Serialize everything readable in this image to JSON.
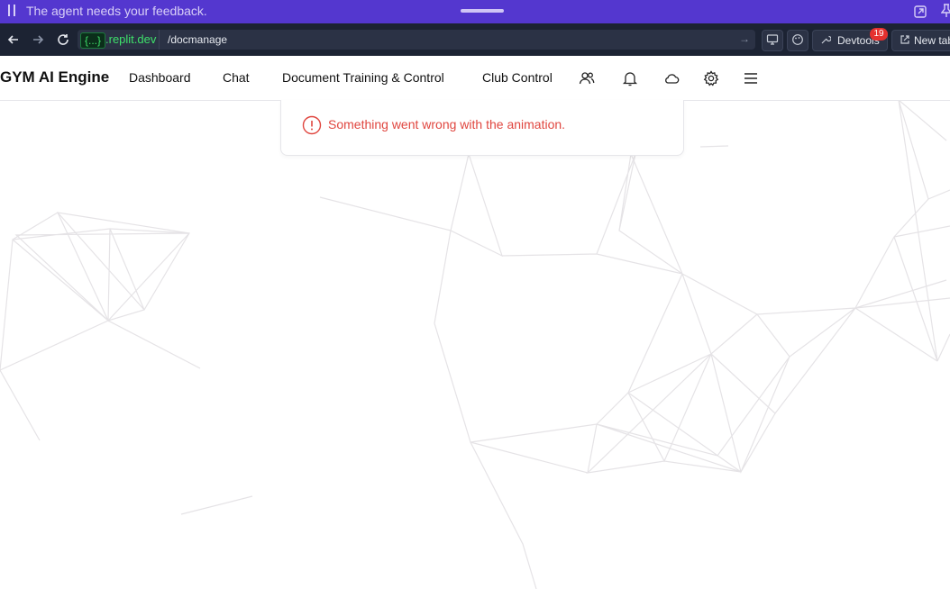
{
  "agent_banner": {
    "message": "The agent needs your feedback."
  },
  "browser": {
    "domain_tag": "{...}",
    "domain": ".replit.dev",
    "path": "/docmanage",
    "devtools_label": "Devtools",
    "devtools_badge": "19",
    "new_tab_label": "New tab"
  },
  "app": {
    "brand": "GYM AI Engine",
    "nav": [
      "Dashboard",
      "Chat",
      "Document Training & Control",
      "Club Control"
    ],
    "icons": [
      "users-icon",
      "bell-icon",
      "cloud-icon",
      "gear-icon",
      "menu-icon"
    ]
  },
  "toast": {
    "message": "Something went wrong with the animation.",
    "color": "#e0463f"
  }
}
